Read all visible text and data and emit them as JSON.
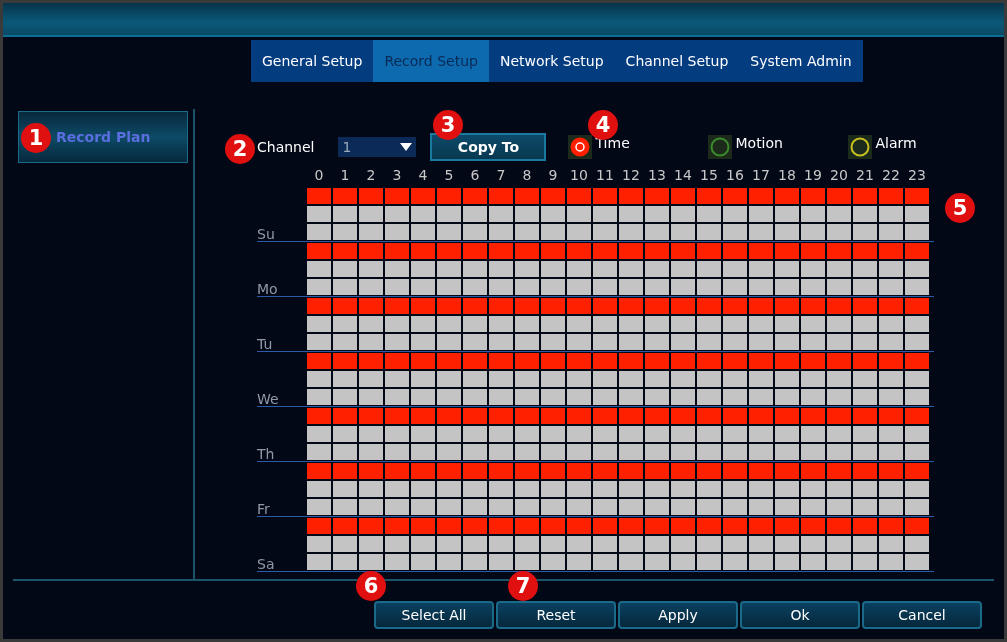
{
  "tabs": [
    {
      "label": "General Setup",
      "selected": false
    },
    {
      "label": "Record Setup",
      "selected": true
    },
    {
      "label": "Network Setup",
      "selected": false
    },
    {
      "label": "Channel Setup",
      "selected": false
    },
    {
      "label": "System Admin",
      "selected": false
    }
  ],
  "sidebar": {
    "items": [
      {
        "label": "Record Plan",
        "selected": true
      }
    ]
  },
  "channel": {
    "label": "Channel",
    "value": "1"
  },
  "copy_button": "Copy To",
  "legend": [
    {
      "label": "Time",
      "color": "#ff2000",
      "selected": true
    },
    {
      "label": "Motion",
      "color": "#3a8a2a",
      "selected": false
    },
    {
      "label": "Alarm",
      "color": "#c8c020",
      "selected": false
    }
  ],
  "hours": [
    "0",
    "1",
    "2",
    "3",
    "4",
    "5",
    "6",
    "7",
    "8",
    "9",
    "10",
    "11",
    "12",
    "13",
    "14",
    "15",
    "16",
    "17",
    "18",
    "19",
    "20",
    "21",
    "22",
    "23"
  ],
  "days": [
    {
      "label": "Su",
      "slots": [
        {
          "recorded": true
        },
        {
          "recorded": false
        },
        {
          "recorded": false
        }
      ]
    },
    {
      "label": "Mo",
      "slots": [
        {
          "recorded": true
        },
        {
          "recorded": false
        },
        {
          "recorded": false
        }
      ]
    },
    {
      "label": "Tu",
      "slots": [
        {
          "recorded": true
        },
        {
          "recorded": false
        },
        {
          "recorded": false
        }
      ]
    },
    {
      "label": "We",
      "slots": [
        {
          "recorded": true
        },
        {
          "recorded": false
        },
        {
          "recorded": false
        }
      ]
    },
    {
      "label": "Th",
      "slots": [
        {
          "recorded": true
        },
        {
          "recorded": false
        },
        {
          "recorded": false
        }
      ]
    },
    {
      "label": "Fr",
      "slots": [
        {
          "recorded": true
        },
        {
          "recorded": false
        },
        {
          "recorded": false
        }
      ]
    },
    {
      "label": "Sa",
      "slots": [
        {
          "recorded": true
        },
        {
          "recorded": false
        },
        {
          "recorded": false
        }
      ]
    }
  ],
  "buttons": [
    "Select All",
    "Reset",
    "Apply",
    "Ok",
    "Cancel"
  ],
  "annotations": [
    {
      "label": "1"
    },
    {
      "label": "2"
    },
    {
      "label": "3"
    },
    {
      "label": "4"
    },
    {
      "label": "5"
    },
    {
      "label": "6"
    },
    {
      "label": "7"
    }
  ]
}
